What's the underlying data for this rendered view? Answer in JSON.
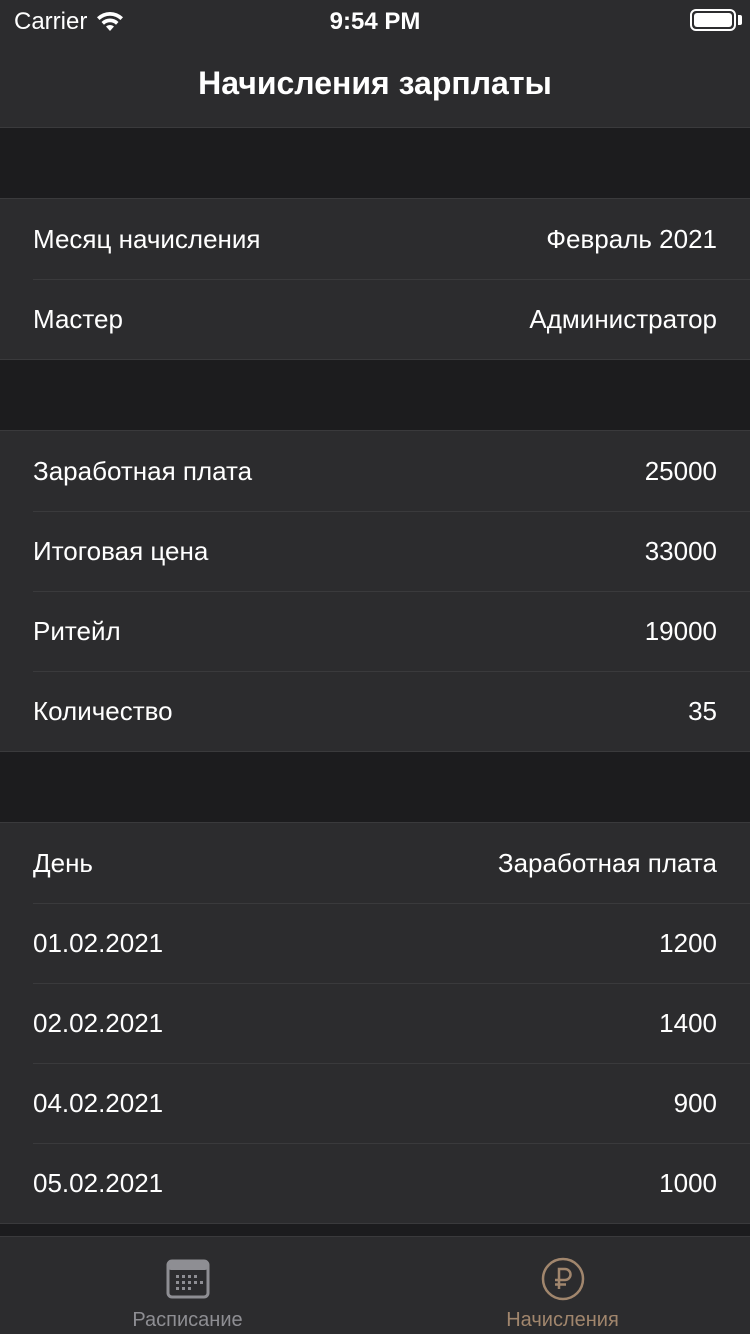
{
  "status": {
    "carrier": "Carrier",
    "time": "9:54 PM"
  },
  "nav": {
    "title": "Начисления зарплаты"
  },
  "info": [
    {
      "label": "Месяц начисления",
      "value": "Февраль 2021"
    },
    {
      "label": "Мастер",
      "value": "Администратор"
    }
  ],
  "summary": [
    {
      "label": "Заработная плата",
      "value": "25000"
    },
    {
      "label": "Итоговая цена",
      "value": "33000"
    },
    {
      "label": "Ритейл",
      "value": "19000"
    },
    {
      "label": "Количество",
      "value": "35"
    }
  ],
  "daily": {
    "header": {
      "day": "День",
      "salary": "Заработная плата"
    },
    "rows": [
      {
        "day": "01.02.2021",
        "salary": "1200"
      },
      {
        "day": "02.02.2021",
        "salary": "1400"
      },
      {
        "day": "04.02.2021",
        "salary": "900"
      },
      {
        "day": "05.02.2021",
        "salary": "1000"
      }
    ]
  },
  "tabs": [
    {
      "label": "Расписание",
      "icon": "calendar-icon",
      "active": false
    },
    {
      "label": "Начисления",
      "icon": "ruble-icon",
      "active": true
    }
  ],
  "colors": {
    "accent": "#a1866d",
    "inactive": "#8e8e93",
    "background": "#1c1c1e",
    "cell": "#2c2c2e"
  }
}
